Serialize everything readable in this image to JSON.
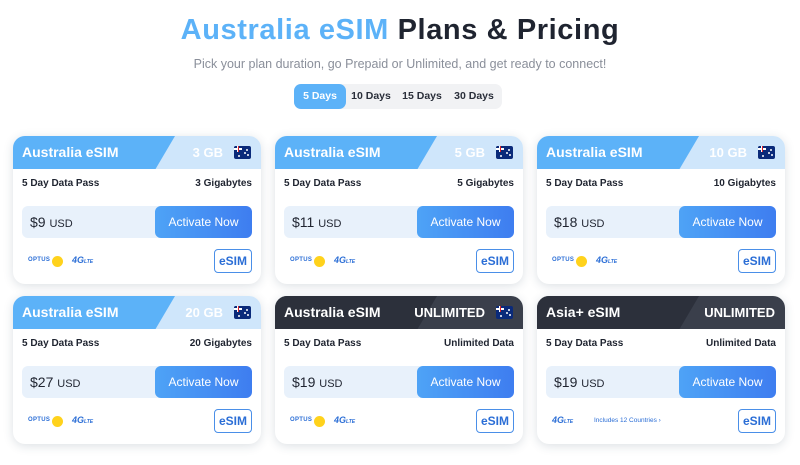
{
  "header": {
    "title_accent": "Australia eSIM",
    "title_rest": "Plans & Pricing",
    "subtitle": "Pick your plan duration, go Prepaid or Unlimited, and get ready to connect!"
  },
  "tabs": [
    {
      "label": "5 Days",
      "active": true
    },
    {
      "label": "10 Days",
      "active": false
    },
    {
      "label": "15 Days",
      "active": false
    },
    {
      "label": "30 Days",
      "active": false
    }
  ],
  "cards": [
    {
      "name": "Australia eSIM",
      "data": "3 GB",
      "pass": "5 Day Data Pass",
      "amount": "3 Gigabytes",
      "price": "$9",
      "currency": "USD",
      "cta": "Activate Now",
      "network": "OPTUS",
      "tech": "4G",
      "tech_sub": "LTE",
      "badge": "eSIM",
      "flag": "australia-flag"
    },
    {
      "name": "Australia eSIM",
      "data": "5 GB",
      "pass": "5 Day Data Pass",
      "amount": "5 Gigabytes",
      "price": "$11",
      "currency": "USD",
      "cta": "Activate Now",
      "network": "OPTUS",
      "tech": "4G",
      "tech_sub": "LTE",
      "badge": "eSIM",
      "flag": "australia-flag"
    },
    {
      "name": "Australia eSIM",
      "data": "10 GB",
      "pass": "5 Day Data Pass",
      "amount": "10 Gigabytes",
      "price": "$18",
      "currency": "USD",
      "cta": "Activate Now",
      "network": "OPTUS",
      "tech": "4G",
      "tech_sub": "LTE",
      "badge": "eSIM",
      "flag": "australia-flag"
    },
    {
      "name": "Australia eSIM",
      "data": "20 GB",
      "pass": "5 Day Data Pass",
      "amount": "20 Gigabytes",
      "price": "$27",
      "currency": "USD",
      "cta": "Activate Now",
      "network": "OPTUS",
      "tech": "4G",
      "tech_sub": "LTE",
      "badge": "eSIM",
      "flag": "australia-flag"
    },
    {
      "name": "Australia eSIM",
      "data": "UNLIMITED",
      "pass": "5 Day Data Pass",
      "amount": "Unlimited Data",
      "price": "$19",
      "currency": "USD",
      "cta": "Activate Now",
      "network": "OPTUS",
      "tech": "4G",
      "tech_sub": "LTE",
      "badge": "eSIM",
      "flag": "australia-flag"
    },
    {
      "name": "Asia+ eSIM",
      "data": "UNLIMITED",
      "pass": "5 Day Data Pass",
      "amount": "Unlimited Data",
      "price": "$19",
      "currency": "USD",
      "cta": "Activate Now",
      "tech": "4G",
      "tech_sub": "LTE",
      "countries": "Includes 12 Countries ›",
      "badge": "eSIM"
    }
  ],
  "colors": {
    "accent": "#5cb2f8",
    "accent_light": "#cfe6fb",
    "dark_header": "#2c303b",
    "button": "#3e7df0",
    "price_box": "#e8f1fb",
    "optus_yellow": "#ffd21c"
  }
}
